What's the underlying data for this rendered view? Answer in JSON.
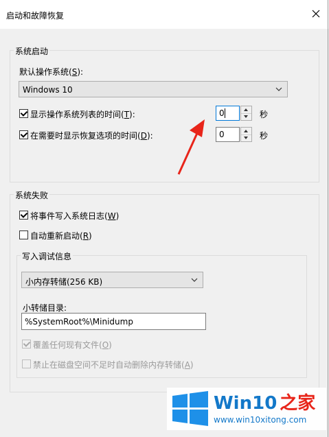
{
  "window": {
    "title": "启动和故障恢复"
  },
  "startup": {
    "group_label": "系统启动",
    "default_os_label": "默认操作系统(",
    "default_os_key": "S",
    "default_os_tail": "):",
    "default_os_value": "Windows 10",
    "show_list": {
      "label": "显示操作系统列表的时间(",
      "key": "T",
      "tail": "):",
      "value": "0",
      "unit": "秒",
      "checked": true
    },
    "show_recovery": {
      "label": "在需要时显示恢复选项的时间(",
      "key": "D",
      "tail": "):",
      "value": "0",
      "unit": "秒",
      "checked": true
    }
  },
  "failure": {
    "group_label": "系统失败",
    "write_event": {
      "label": "将事件写入系统日志(",
      "key": "W",
      "tail": ")",
      "checked": true
    },
    "auto_restart": {
      "label": "自动重新启动(",
      "key": "R",
      "tail": ")",
      "checked": false
    },
    "debug": {
      "group_label": "写入调试信息",
      "dump_type": "小内存转储(256 KB)",
      "dir_label": "小转储目录:",
      "dir_value": "%SystemRoot%\\Minidump",
      "overwrite": {
        "label": "覆盖任何现有文件(",
        "key": "O",
        "tail": ")",
        "checked": true,
        "disabled": true
      },
      "disable_auto_delete": {
        "label": "禁止在磁盘空间不足时自动删除内存转储(",
        "key": "A",
        "tail": ")",
        "checked": false,
        "disabled": true
      }
    }
  },
  "watermark": {
    "brand_win": "Win10",
    "brand_suffix": "之家",
    "url": "www.win10xitong.com"
  },
  "colors": {
    "arrow": "#e8251a",
    "win_logo": "#1e90e8",
    "brand_text": "#1378c9"
  }
}
